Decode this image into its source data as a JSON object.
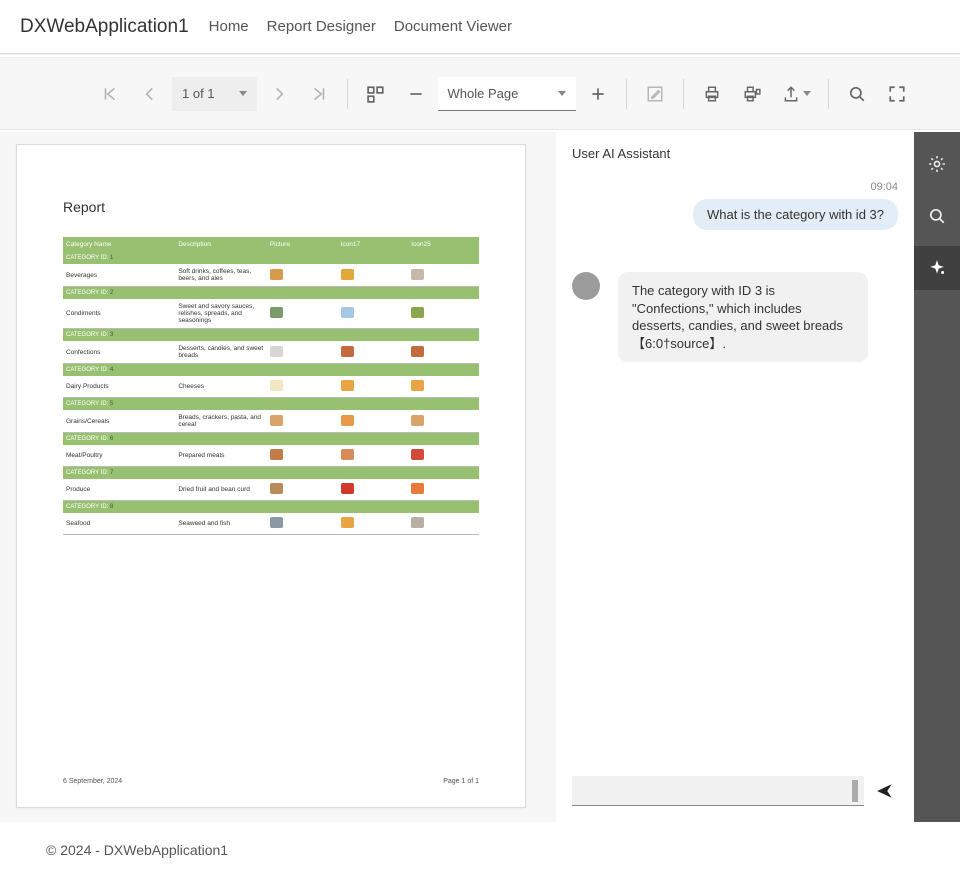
{
  "nav": {
    "brand": "DXWebApplication1",
    "links": [
      "Home",
      "Report Designer",
      "Document Viewer"
    ]
  },
  "toolbar": {
    "page_selector": "1 of 1",
    "zoom_selector": "Whole Page"
  },
  "report": {
    "title": "Report",
    "headers": [
      "Category Name",
      "Description",
      "Picture",
      "Icon17",
      "Icon25"
    ],
    "group_label": "CATEGORY ID:",
    "rows": [
      {
        "id": "1",
        "name": "Beverages",
        "desc": "Soft drinks, coffees, teas, beers, and ales",
        "c1": "#d79b4b",
        "c2": "#e3a83a",
        "c3": "#c7b9aa"
      },
      {
        "id": "2",
        "name": "Condiments",
        "desc": "Sweet and savory sauces, relishes, spreads, and seasonings",
        "c1": "#7b9b6a",
        "c2": "#a8c6e6",
        "c3": "#8aa64f"
      },
      {
        "id": "3",
        "name": "Confections",
        "desc": "Desserts, candies, and sweet breads",
        "c1": "#d8d6d2",
        "c2": "#c46a3f",
        "c3": "#c46a3f"
      },
      {
        "id": "4",
        "name": "Dairy Products",
        "desc": "Cheeses",
        "c1": "#f2e7c2",
        "c2": "#e7a545",
        "c3": "#e7a545"
      },
      {
        "id": "5",
        "name": "Grains/Cereals",
        "desc": "Breads, crackers, pasta, and cereal",
        "c1": "#d9a36a",
        "c2": "#e79a4a",
        "c3": "#d9a36a"
      },
      {
        "id": "6",
        "name": "Meat/Poultry",
        "desc": "Prepared meats",
        "c1": "#c47b4a",
        "c2": "#d88b5a",
        "c3": "#d24a3a"
      },
      {
        "id": "7",
        "name": "Produce",
        "desc": "Dried fruit and bean curd",
        "c1": "#b88b5a",
        "c2": "#d13a2a",
        "c3": "#e87a3a"
      },
      {
        "id": "8",
        "name": "Seafood",
        "desc": "Seaweed and fish",
        "c1": "#8a9aa2",
        "c2": "#e7a545",
        "c3": "#b8b0a4"
      }
    ],
    "footer_date": "6 September, 2024",
    "footer_page": "Page 1 of 1"
  },
  "chat": {
    "title": "User AI Assistant",
    "time": "09:04",
    "user_msg": "What is the category with id 3?",
    "asst_msg": "The category with ID 3 is \"Confections,\" which includes desserts, candies, and sweet breads 【6:0†source】."
  },
  "footer": "© 2024 - DXWebApplication1"
}
